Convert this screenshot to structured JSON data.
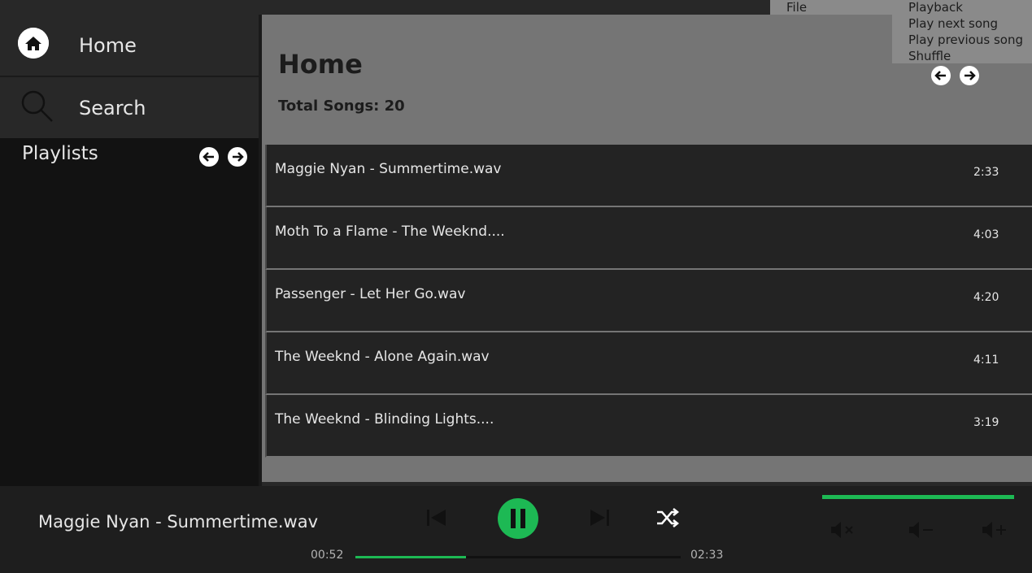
{
  "sidebar": {
    "home_label": "Home",
    "search_label": "Search",
    "playlists_label": "Playlists"
  },
  "menu": {
    "file_label": "File",
    "playback_label": "Playback",
    "playback_items": [
      "Play next song",
      "Play previous song",
      "Shuffle"
    ]
  },
  "main": {
    "title": "Home",
    "total_songs": "Total Songs: 20",
    "songs": [
      {
        "title": "Maggie Nyan - Summertime.wav",
        "duration": "2:33"
      },
      {
        "title": "Moth To a Flame - The Weeknd....",
        "duration": "4:03"
      },
      {
        "title": "Passenger - Let Her Go.wav",
        "duration": "4:20"
      },
      {
        "title": "The Weeknd - Alone Again.wav",
        "duration": "4:11"
      },
      {
        "title": "The Weeknd - Blinding Lights....",
        "duration": "3:19"
      }
    ]
  },
  "player": {
    "now_playing": "Maggie Nyan - Summertime.wav",
    "elapsed": "00:52",
    "total": "02:33",
    "progress_percent": 34,
    "volume_percent": 100
  },
  "colors": {
    "accent": "#1db954",
    "sidebar_bg": "#121212",
    "main_bg": "#757575",
    "row_bg": "#232323"
  }
}
